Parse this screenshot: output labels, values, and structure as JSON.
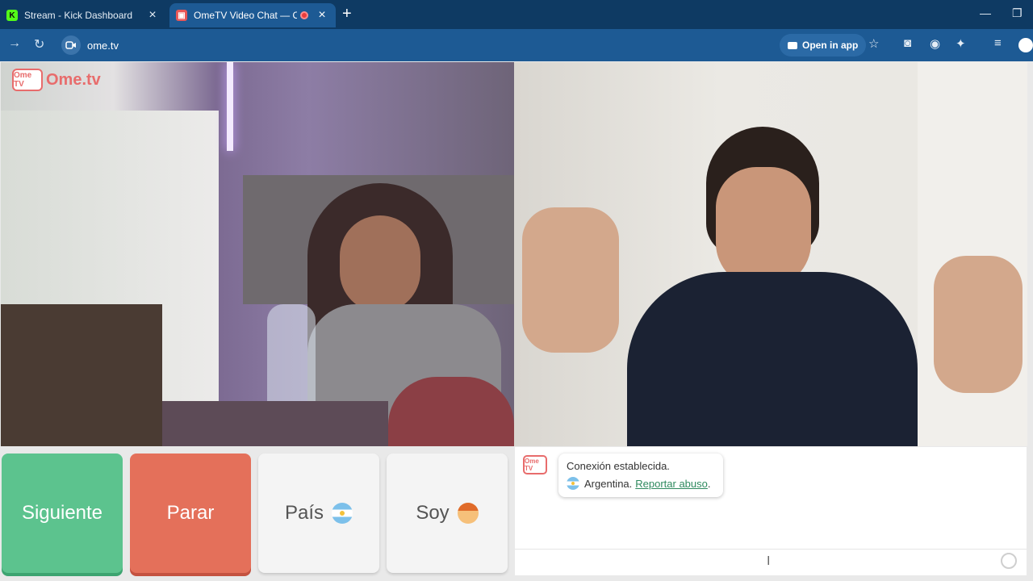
{
  "tabs": [
    {
      "title": "Stream - Kick Dashboard",
      "favicon": "kick-icon",
      "active": false
    },
    {
      "title": "OmeTV Video Chat — Ome",
      "favicon": "ometv-icon",
      "active": true
    }
  ],
  "toolbar": {
    "url": "ome.tv",
    "open_in_app": "Open in app"
  },
  "video": {
    "logo_text": "Ome.tv",
    "logo_badge": "Ome TV"
  },
  "controls": {
    "siguiente": "Siguiente",
    "parar": "Parar",
    "pais": "País",
    "soy": "Soy"
  },
  "chat": {
    "status": "Conexión establecida.",
    "country": "Argentina.",
    "report": "Reportar abuso",
    "report_end": ".",
    "logo_badge": "Ome TV"
  },
  "colors": {
    "siguiente": "#5cc38e",
    "parar": "#e4705a",
    "accent": "#2f8a5f"
  }
}
